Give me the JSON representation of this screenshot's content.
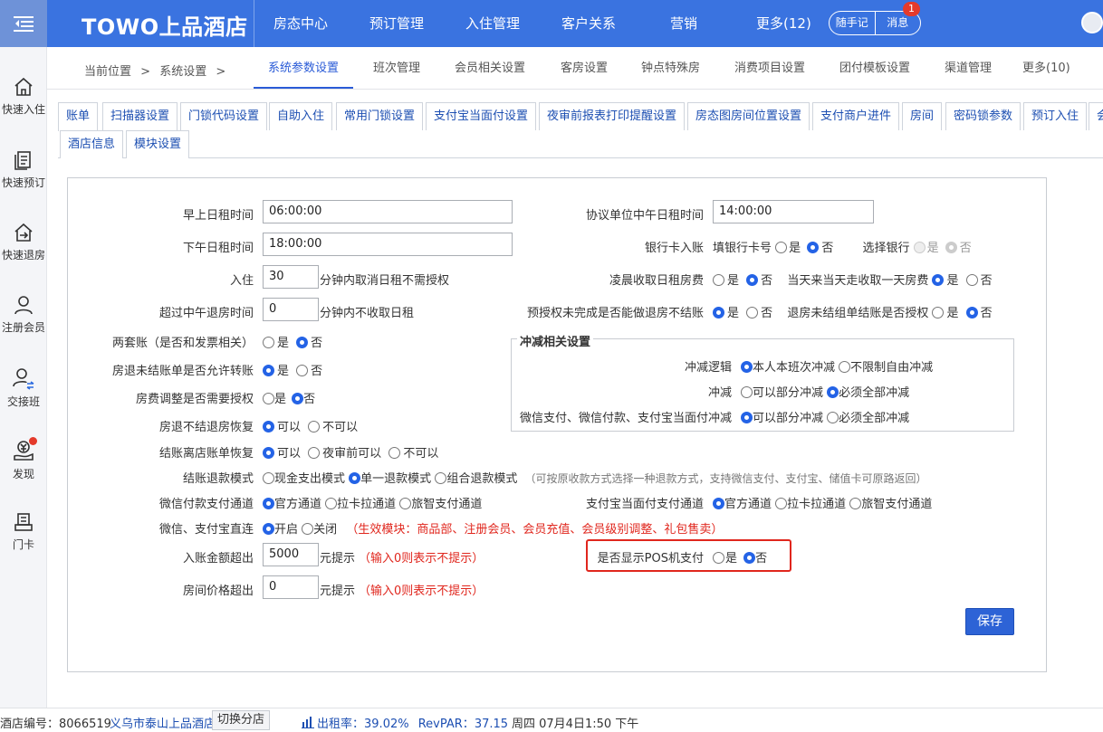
{
  "app": {
    "logo": "TOWO上品酒店"
  },
  "topnav": {
    "items": [
      "房态中心",
      "预订管理",
      "入住管理",
      "客户关系",
      "营销",
      "更多(12)"
    ],
    "notes": "随手记",
    "messages": "消息",
    "message_count": "1"
  },
  "sidebar": {
    "items": [
      "快速入住",
      "快速预订",
      "快速退房",
      "注册会员",
      "交接班",
      "发现",
      "门卡"
    ]
  },
  "breadcrumb": {
    "current": "当前位置",
    "sep": ">",
    "page": "系统设置",
    "sep2": ">"
  },
  "module_tabs": [
    "系统参数设置",
    "班次管理",
    "会员相关设置",
    "客房设置",
    "钟点特殊房",
    "消费项目设置",
    "团付模板设置",
    "渠道管理",
    "更多(10)"
  ],
  "setting_tabs": {
    "row1": [
      "账单",
      "扫描器设置",
      "门锁代码设置",
      "自助入住",
      "常用门锁设置",
      "支付宝当面付设置",
      "夜审前报表打印提醒设置",
      "房态图房间位置设置",
      "支付商户进件",
      "房间",
      "密码锁参数",
      "预订入住",
      "会"
    ],
    "row2": [
      "酒店信息",
      "模块设置"
    ]
  },
  "form": {
    "morning_label": "早上日租时间",
    "morning_value": "06:00:00",
    "afternoon_label": "下午日租时间",
    "afternoon_value": "18:00:00",
    "checkin_label": "入住",
    "checkin_value": "30",
    "checkin_suffix": "分钟内取消日租不需授权",
    "noon_label": "超过中午退房时间",
    "noon_value": "0",
    "noon_suffix": "分钟内不收取日租",
    "dual_label": "两套账（是否和发票相关）",
    "unsettled_label": "房退未结账单是否允许转账",
    "adjust_label": "房费调整是否需要授权",
    "restore_label": "房退不结退房恢复",
    "checkout_restore_label": "结账离店账单恢复",
    "refund_mode_label": "结账退款模式",
    "refund_opt1": "现金支出模式",
    "refund_opt2": "单一退款模式",
    "refund_opt3": "组合退款模式",
    "refund_note": "（可按原收款方式选择一种退款方式，支持微信支付、支付宝、储值卡可原路返回）",
    "wechat_channel_label": "微信付款支付通道",
    "alipay_channel_label": "支付宝当面付支付通道",
    "channel_opt1": "官方通道",
    "channel_opt2": "拉卡拉通道",
    "channel_opt3": "旅智支付通道",
    "direct_label": "微信、支付宝直连",
    "direct_on": "开启",
    "direct_off": "关闭",
    "direct_note": "（生效模块：商品部、注册会员、会员充值、会员级别调整、礼包售卖）",
    "entry_label": "入账金额超出",
    "entry_value": "5000",
    "entry_suffix": "元提示",
    "room_price_label": "房间价格超出",
    "room_price_value": "0",
    "room_price_suffix": "元提示",
    "zero_note": "（输入0则表示不提示）",
    "pos_label": "是否显示POS机支付",
    "agreement_label": "协议单位中午日租时间",
    "agreement_value": "14:00:00",
    "bankcard_label": "银行卡入账",
    "fill_card": "填银行卡号",
    "choose_bank": "选择银行",
    "early_fee_label": "凌晨收取日租房费",
    "same_day_label": "当天来当天走收取一天房费",
    "preauth_label": "预授权未完成是否能做退房不结账",
    "group_label": "退房未结组单结账是否授权",
    "offset_title": "冲减相关设置",
    "offset_logic_label": "冲减逻辑",
    "offset_logic_opt1": "本人本班次冲减",
    "offset_logic_opt2": "不限制自由冲减",
    "offset_label": "冲减",
    "offset_opt1": "可以部分冲减",
    "offset_opt2": "必须全部冲减",
    "offset_pay_label": "微信支付、微信付款、支付宝当面付冲减",
    "yes": "是",
    "no": "否",
    "can": "可以",
    "cannot": "不可以",
    "before_audit": "夜审前可以",
    "save": "保存"
  },
  "footer": {
    "hotel_no_label": "酒店编号：",
    "hotel_no": "8066519",
    "hotel_name": "义乌市泰山上品酒店",
    "switch": "切换分店",
    "occupancy_label": "出租率：",
    "occupancy": "39.02%",
    "revpar_label": "RevPAR：",
    "revpar": "37.15",
    "datetime": "周四 07月4日1:50 下午"
  },
  "colors": {
    "topbar": "#3a73e0",
    "accent": "#2a5bd7",
    "warning": "#e0261d"
  }
}
